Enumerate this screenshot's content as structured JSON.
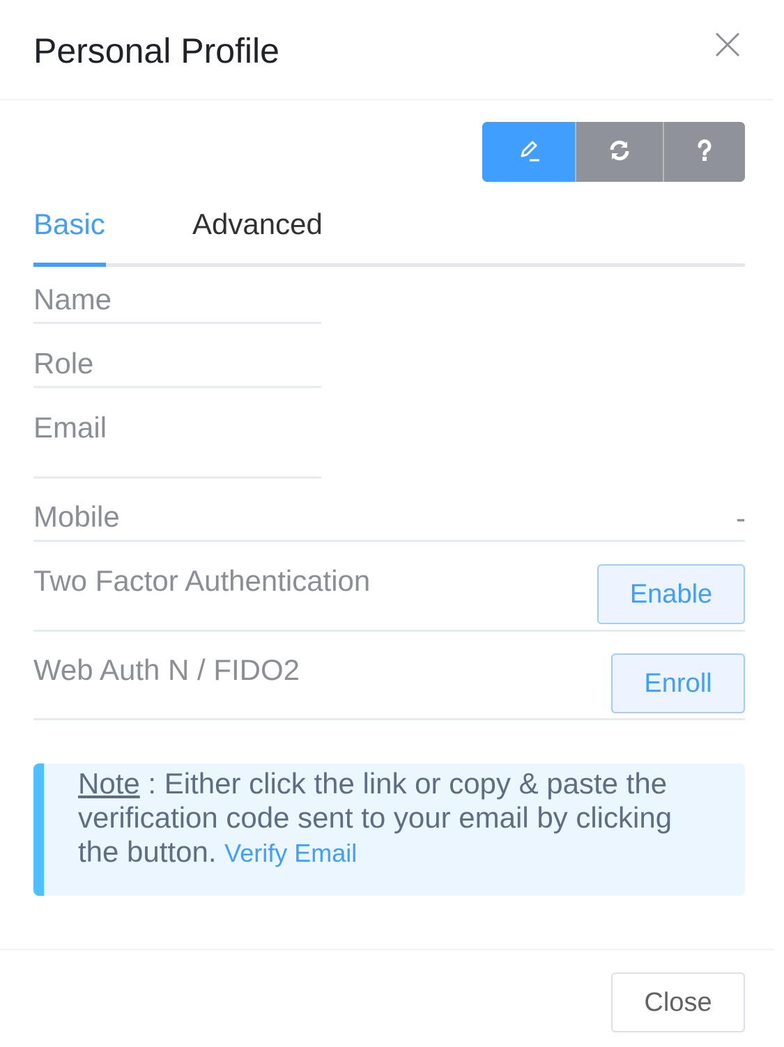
{
  "dialog": {
    "title": "Personal Profile",
    "close_icon": "close-icon"
  },
  "toolbar": {
    "buttons": [
      {
        "icon": "edit-icon",
        "state": "active",
        "color": "#409eff"
      },
      {
        "icon": "refresh-icon",
        "color": "#8f9399"
      },
      {
        "icon": "question-icon",
        "color": "#8f9399"
      }
    ]
  },
  "tabs": [
    {
      "label": "Basic",
      "active": true
    },
    {
      "label": "Advanced",
      "active": false
    }
  ],
  "fields": {
    "name": {
      "label": "Name",
      "value": ""
    },
    "role": {
      "label": "Role",
      "value": ""
    },
    "email": {
      "label": "Email",
      "value": ""
    },
    "mobile": {
      "label": "Mobile",
      "value": "-"
    },
    "two_factor": {
      "label": "Two Factor Authentication",
      "button": "Enable"
    },
    "webauthn": {
      "label": "Web Auth N / FIDO2",
      "button": "Enroll"
    }
  },
  "note": {
    "strong": "Note",
    "text": " : Either click the link or copy & paste the verification code sent to your email by clicking the button. ",
    "link": "Verify Email"
  },
  "footer": {
    "close_label": "Close"
  },
  "colors": {
    "primary": "#409eff",
    "note_background": "#ecf6fe",
    "note_accent": "#50bfff"
  }
}
